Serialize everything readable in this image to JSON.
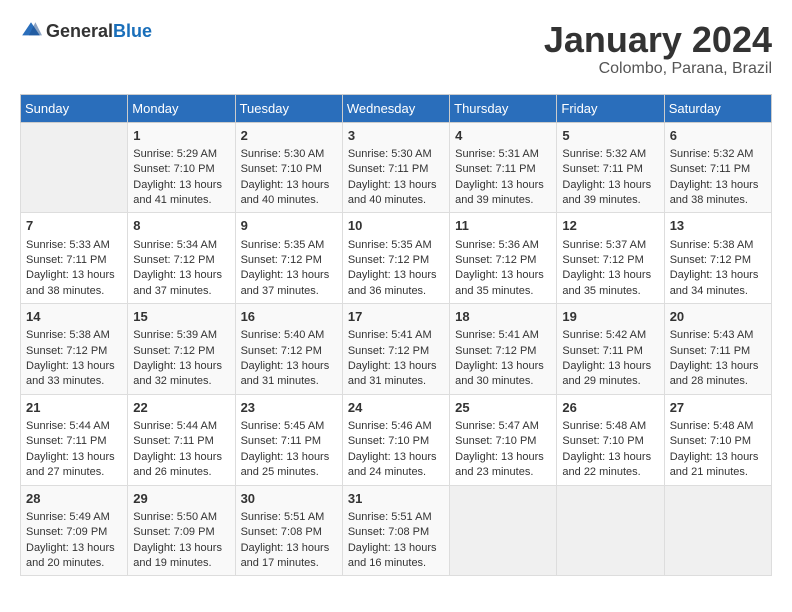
{
  "header": {
    "logo_general": "General",
    "logo_blue": "Blue",
    "title": "January 2024",
    "subtitle": "Colombo, Parana, Brazil"
  },
  "days_of_week": [
    "Sunday",
    "Monday",
    "Tuesday",
    "Wednesday",
    "Thursday",
    "Friday",
    "Saturday"
  ],
  "weeks": [
    [
      {
        "day": "",
        "content": ""
      },
      {
        "day": "1",
        "content": "Sunrise: 5:29 AM\nSunset: 7:10 PM\nDaylight: 13 hours\nand 41 minutes."
      },
      {
        "day": "2",
        "content": "Sunrise: 5:30 AM\nSunset: 7:10 PM\nDaylight: 13 hours\nand 40 minutes."
      },
      {
        "day": "3",
        "content": "Sunrise: 5:30 AM\nSunset: 7:11 PM\nDaylight: 13 hours\nand 40 minutes."
      },
      {
        "day": "4",
        "content": "Sunrise: 5:31 AM\nSunset: 7:11 PM\nDaylight: 13 hours\nand 39 minutes."
      },
      {
        "day": "5",
        "content": "Sunrise: 5:32 AM\nSunset: 7:11 PM\nDaylight: 13 hours\nand 39 minutes."
      },
      {
        "day": "6",
        "content": "Sunrise: 5:32 AM\nSunset: 7:11 PM\nDaylight: 13 hours\nand 38 minutes."
      }
    ],
    [
      {
        "day": "7",
        "content": "Sunrise: 5:33 AM\nSunset: 7:11 PM\nDaylight: 13 hours\nand 38 minutes."
      },
      {
        "day": "8",
        "content": "Sunrise: 5:34 AM\nSunset: 7:12 PM\nDaylight: 13 hours\nand 37 minutes."
      },
      {
        "day": "9",
        "content": "Sunrise: 5:35 AM\nSunset: 7:12 PM\nDaylight: 13 hours\nand 37 minutes."
      },
      {
        "day": "10",
        "content": "Sunrise: 5:35 AM\nSunset: 7:12 PM\nDaylight: 13 hours\nand 36 minutes."
      },
      {
        "day": "11",
        "content": "Sunrise: 5:36 AM\nSunset: 7:12 PM\nDaylight: 13 hours\nand 35 minutes."
      },
      {
        "day": "12",
        "content": "Sunrise: 5:37 AM\nSunset: 7:12 PM\nDaylight: 13 hours\nand 35 minutes."
      },
      {
        "day": "13",
        "content": "Sunrise: 5:38 AM\nSunset: 7:12 PM\nDaylight: 13 hours\nand 34 minutes."
      }
    ],
    [
      {
        "day": "14",
        "content": "Sunrise: 5:38 AM\nSunset: 7:12 PM\nDaylight: 13 hours\nand 33 minutes."
      },
      {
        "day": "15",
        "content": "Sunrise: 5:39 AM\nSunset: 7:12 PM\nDaylight: 13 hours\nand 32 minutes."
      },
      {
        "day": "16",
        "content": "Sunrise: 5:40 AM\nSunset: 7:12 PM\nDaylight: 13 hours\nand 31 minutes."
      },
      {
        "day": "17",
        "content": "Sunrise: 5:41 AM\nSunset: 7:12 PM\nDaylight: 13 hours\nand 31 minutes."
      },
      {
        "day": "18",
        "content": "Sunrise: 5:41 AM\nSunset: 7:12 PM\nDaylight: 13 hours\nand 30 minutes."
      },
      {
        "day": "19",
        "content": "Sunrise: 5:42 AM\nSunset: 7:11 PM\nDaylight: 13 hours\nand 29 minutes."
      },
      {
        "day": "20",
        "content": "Sunrise: 5:43 AM\nSunset: 7:11 PM\nDaylight: 13 hours\nand 28 minutes."
      }
    ],
    [
      {
        "day": "21",
        "content": "Sunrise: 5:44 AM\nSunset: 7:11 PM\nDaylight: 13 hours\nand 27 minutes."
      },
      {
        "day": "22",
        "content": "Sunrise: 5:44 AM\nSunset: 7:11 PM\nDaylight: 13 hours\nand 26 minutes."
      },
      {
        "day": "23",
        "content": "Sunrise: 5:45 AM\nSunset: 7:11 PM\nDaylight: 13 hours\nand 25 minutes."
      },
      {
        "day": "24",
        "content": "Sunrise: 5:46 AM\nSunset: 7:10 PM\nDaylight: 13 hours\nand 24 minutes."
      },
      {
        "day": "25",
        "content": "Sunrise: 5:47 AM\nSunset: 7:10 PM\nDaylight: 13 hours\nand 23 minutes."
      },
      {
        "day": "26",
        "content": "Sunrise: 5:48 AM\nSunset: 7:10 PM\nDaylight: 13 hours\nand 22 minutes."
      },
      {
        "day": "27",
        "content": "Sunrise: 5:48 AM\nSunset: 7:10 PM\nDaylight: 13 hours\nand 21 minutes."
      }
    ],
    [
      {
        "day": "28",
        "content": "Sunrise: 5:49 AM\nSunset: 7:09 PM\nDaylight: 13 hours\nand 20 minutes."
      },
      {
        "day": "29",
        "content": "Sunrise: 5:50 AM\nSunset: 7:09 PM\nDaylight: 13 hours\nand 19 minutes."
      },
      {
        "day": "30",
        "content": "Sunrise: 5:51 AM\nSunset: 7:08 PM\nDaylight: 13 hours\nand 17 minutes."
      },
      {
        "day": "31",
        "content": "Sunrise: 5:51 AM\nSunset: 7:08 PM\nDaylight: 13 hours\nand 16 minutes."
      },
      {
        "day": "",
        "content": ""
      },
      {
        "day": "",
        "content": ""
      },
      {
        "day": "",
        "content": ""
      }
    ]
  ]
}
